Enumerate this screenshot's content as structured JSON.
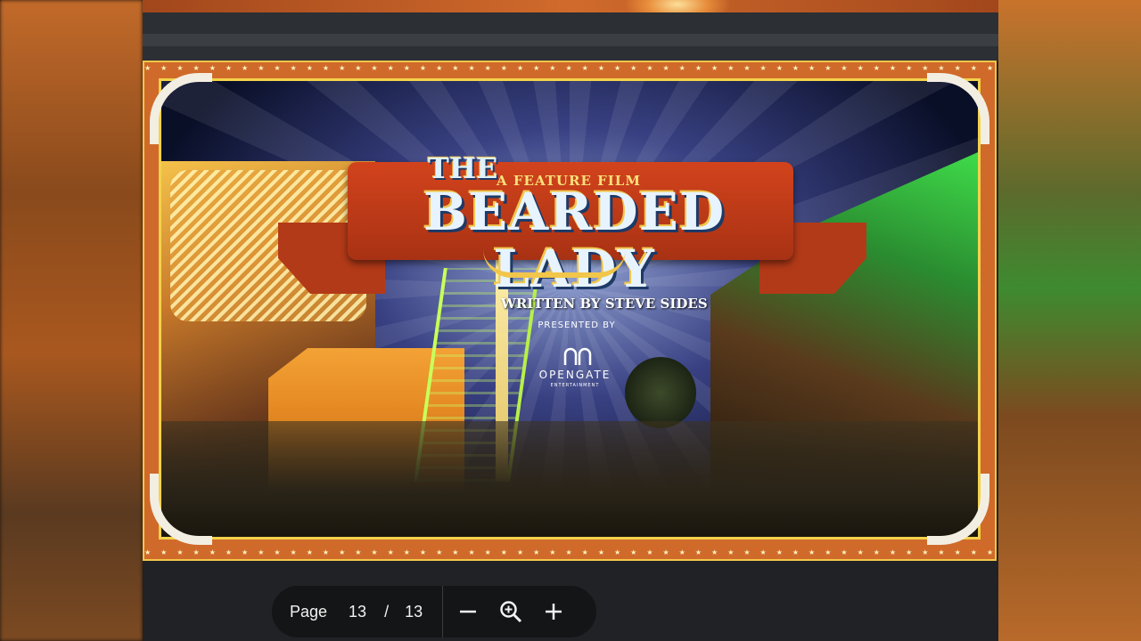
{
  "slide": {
    "title_top": "THE",
    "subtitle": "A FEATURE FILM",
    "title_main": "BEARDED LADY",
    "credit": "WRITTEN BY STEVE SIDES",
    "presented_by": "PRESENTED BY",
    "company": "OPENGATE",
    "company_tag": "ENTERTAINMENT"
  },
  "toolbar": {
    "page_label": "Page",
    "current_page": "13",
    "separator": "/",
    "total_pages": "13",
    "icons": [
      "zoom-out-icon",
      "magnifier-icon",
      "zoom-in-icon"
    ]
  },
  "colors": {
    "frame_orange": "#d06a2a",
    "frame_gold": "#f3d24b",
    "banner_red": "#c43c18",
    "toolbar_bg": "#141516"
  }
}
